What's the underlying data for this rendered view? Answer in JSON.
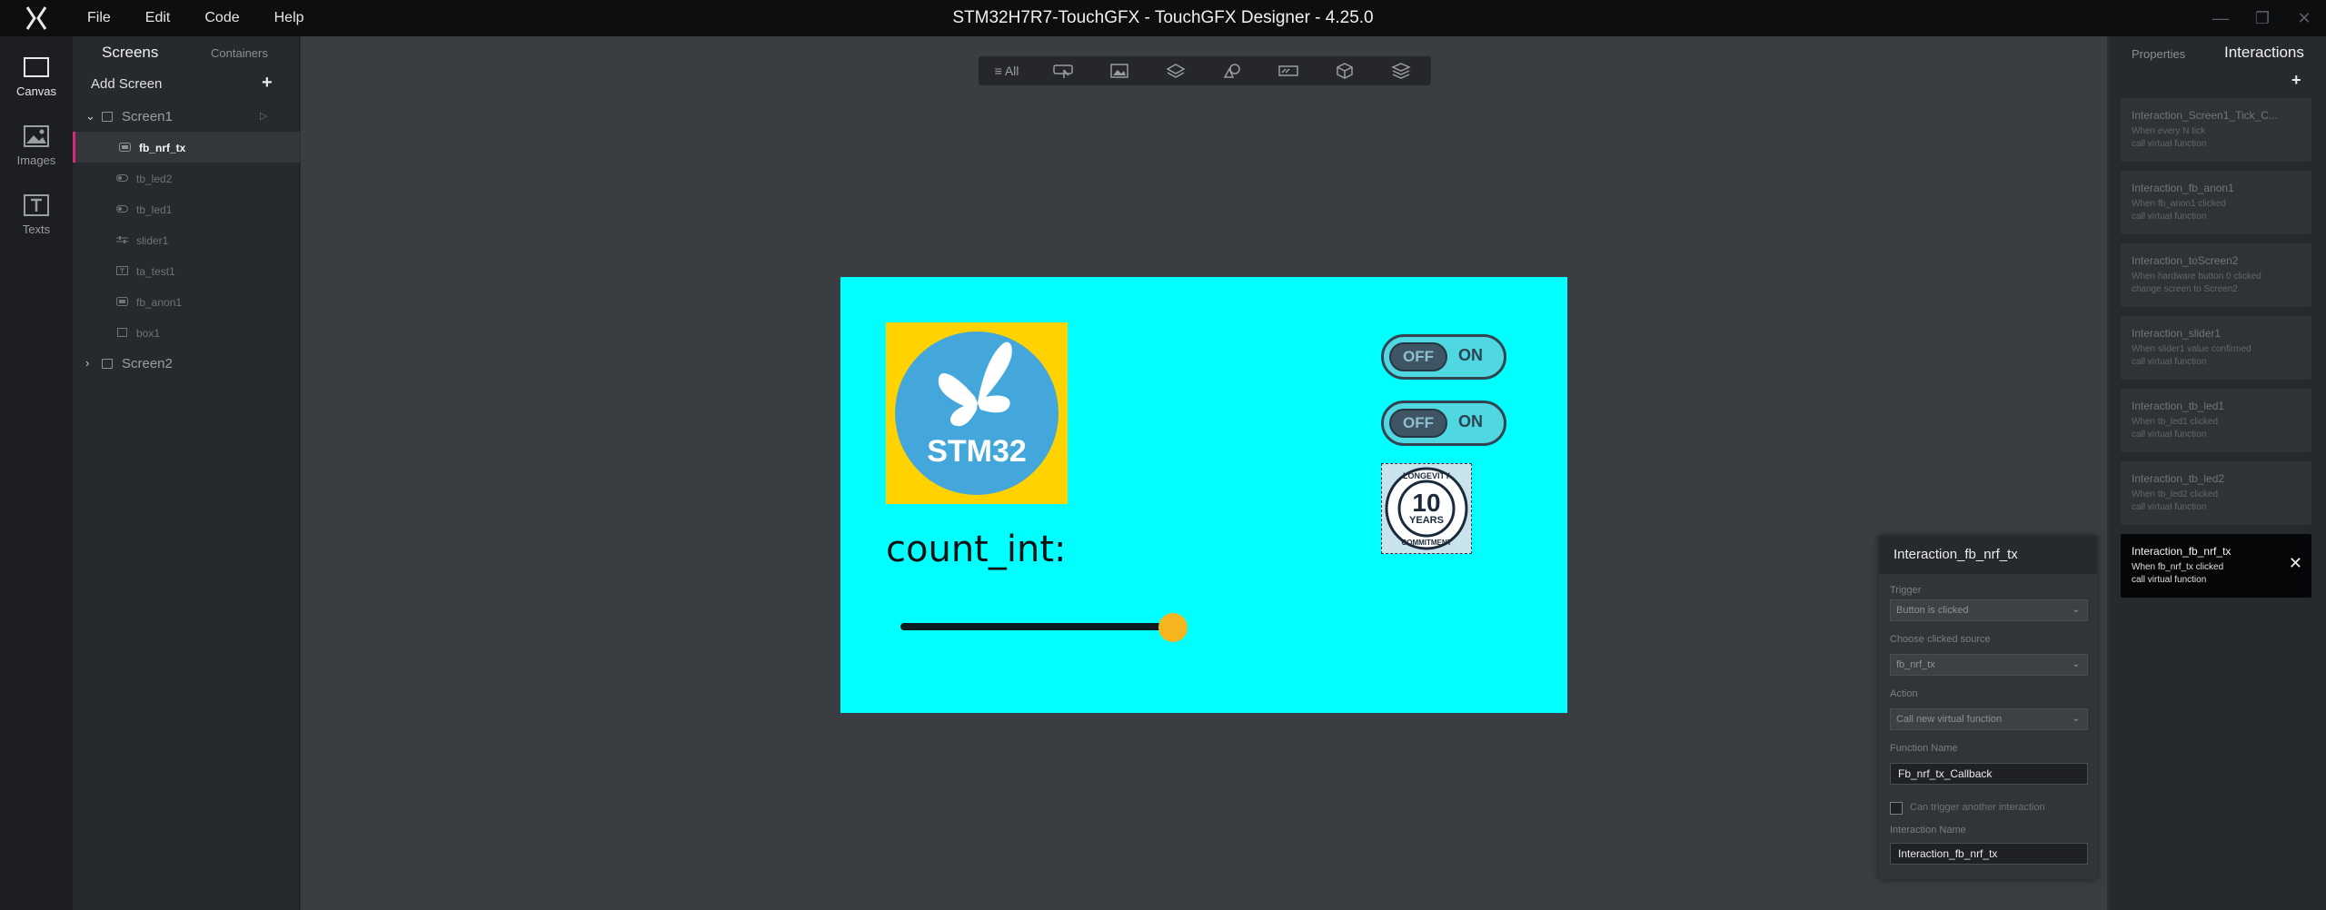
{
  "window": {
    "title": "STM32H7R7-TouchGFX - TouchGFX Designer - 4.25.0",
    "menu": [
      "File",
      "Edit",
      "Code",
      "Help"
    ],
    "minimize": "—",
    "restore": "❐",
    "close": "✕"
  },
  "rail": {
    "items": [
      {
        "label": "Canvas",
        "icon": "canvas-icon"
      },
      {
        "label": "Images",
        "icon": "images-icon"
      },
      {
        "label": "Texts",
        "icon": "texts-icon"
      }
    ]
  },
  "screens": {
    "tab_screens": "Screens",
    "tab_containers": "Containers",
    "add_screen": "Add Screen",
    "add_symbol": "+",
    "screen1": "Screen1",
    "screen2": "Screen2",
    "children": [
      {
        "name": "fb_nrf_tx",
        "icon": "flex-button-icon"
      },
      {
        "name": "tb_led2",
        "icon": "toggle-button-icon"
      },
      {
        "name": "tb_led1",
        "icon": "toggle-button-icon"
      },
      {
        "name": "slider1",
        "icon": "slider-icon"
      },
      {
        "name": "ta_test1",
        "icon": "text-area-icon"
      },
      {
        "name": "fb_anon1",
        "icon": "flex-button-icon"
      },
      {
        "name": "box1",
        "icon": "box-icon"
      }
    ]
  },
  "toolbar": {
    "all_label": "≡ All"
  },
  "canvas": {
    "count_label": "count_int:",
    "logo_text": "STM32",
    "toggle_off": "OFF",
    "toggle_on": "ON",
    "badge_top": "LONGEVITY",
    "badge_num": "10",
    "badge_mid": "YEARS",
    "badge_bottom": "COMMITMENT",
    "slider_value_fraction": 0.97,
    "background_color": "#00ffff"
  },
  "props": {
    "tab_properties": "Properties",
    "tab_interactions": "Interactions",
    "add_symbol": "+",
    "interactions": [
      {
        "name": "Interaction_Screen1_Tick_C...",
        "l1": "When every N tick",
        "l2": "call virtual function"
      },
      {
        "name": "Interaction_fb_anon1",
        "l1": "When fb_anon1 clicked",
        "l2": "call virtual function"
      },
      {
        "name": "Interaction_toScreen2",
        "l1": "When hardware button 0 clicked",
        "l2": "change screen to Screen2"
      },
      {
        "name": "Interaction_slider1",
        "l1": "When slider1 value confirmed",
        "l2": "call virtual function"
      },
      {
        "name": "Interaction_tb_led1",
        "l1": "When tb_led1 clicked",
        "l2": "call virtual function"
      },
      {
        "name": "Interaction_tb_led2",
        "l1": "When tb_led2 clicked",
        "l2": "call virtual function"
      },
      {
        "name": "Interaction_fb_nrf_tx",
        "l1": "When fb_nrf_tx clicked",
        "l2": "call virtual function"
      }
    ],
    "close": "✕"
  },
  "editor": {
    "title": "Interaction_fb_nrf_tx",
    "trigger_label": "Trigger",
    "trigger_value": "Button is clicked",
    "source_label": "Choose clicked source",
    "source_value": "fb_nrf_tx",
    "action_label": "Action",
    "action_value": "Call new virtual function",
    "function_label": "Function Name",
    "function_value": "Fb_nrf_tx_Callback",
    "check_label": "Can trigger another interaction",
    "iname_label": "Interaction Name",
    "iname_value": "Interaction_fb_nrf_tx",
    "dropdown_glyph": "⌄"
  }
}
